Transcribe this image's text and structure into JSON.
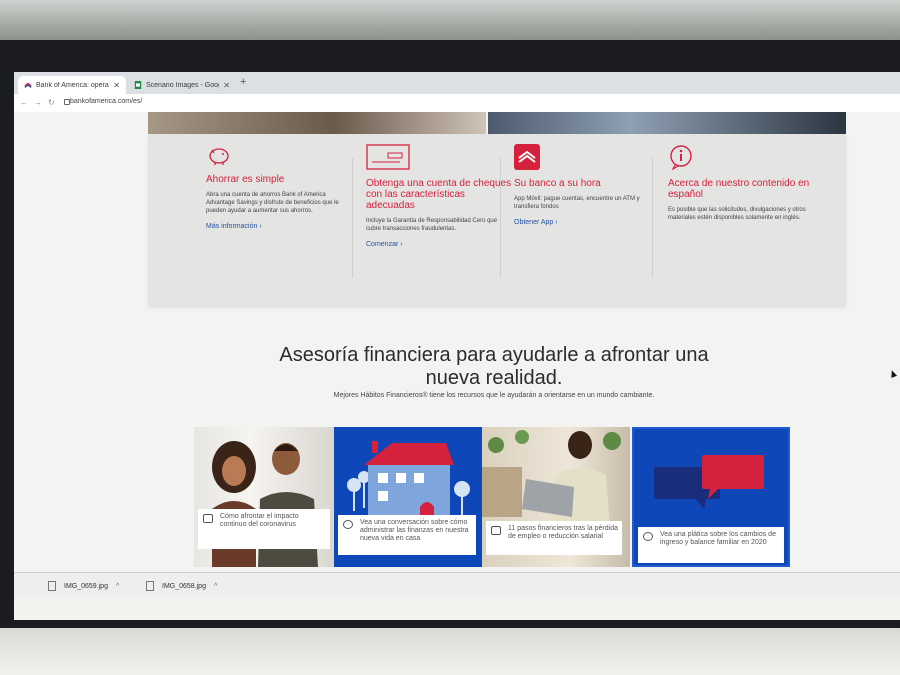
{
  "browser": {
    "tabs": [
      {
        "label": "Bank of America: operaciones ba"
      },
      {
        "label": "Scenario Images - Google Shee"
      }
    ],
    "url": "bankofamerica.com/es/"
  },
  "cards": [
    {
      "title": "Ahorrar es simple",
      "body": "Abra una cuenta de ahorros Bank of America Advantage Savings y disfrute de beneficios que le pueden ayudar a aumentar sus ahorros.",
      "link": "Más información"
    },
    {
      "title": "Obtenga una cuenta de cheques con las características adecuadas",
      "body": "Incluye la Garantía de Responsabilidad Cero que cubre transacciones fraudulentas.",
      "link": "Comenzar"
    },
    {
      "title": "Su banco a su hora",
      "body": "App Móvil: pague cuentas, encuentre un ATM y transfiera fondos",
      "link": "Obtener App"
    },
    {
      "title": "Acerca de nuestro contenido en español",
      "body": "Es posible que las solicitudes, divulgaciones y otros materiales estén disponibles solamente en inglés.",
      "link": ""
    }
  ],
  "section": {
    "headline_line1": "Asesoría financiera para ayudarle a afrontar una",
    "headline_line2": "nueva realidad.",
    "subtitle": "Mejores Hábitos Financieros® tiene los recursos que le ayudarán a orientarse en un mundo cambiante."
  },
  "tiles": [
    {
      "caption": "Cómo afrontar el impacto continuo del coronavirus"
    },
    {
      "caption": "Vea una conversación sobre cómo administrar las finanzas en nuestra nueva vida en casa"
    },
    {
      "caption": "11 pasos financieros tras la pérdida de empleo o reducción salarial"
    },
    {
      "caption": "Vea una plática sobre los cambios de ingreso y balance familiar en 2020"
    }
  ],
  "downloads": [
    {
      "name": "IMG_0659.jpg"
    },
    {
      "name": "IMG_0658.jpg"
    }
  ],
  "colors": {
    "accent_red": "#d6213d",
    "link_blue": "#2452a3",
    "tile_blue": "#0d47b8"
  },
  "icons": {
    "browser_close": "✕",
    "new_tab": "+",
    "back": "←",
    "forward": "→",
    "reload": "↻",
    "link_chevron": "›",
    "download_chevron": "^"
  }
}
